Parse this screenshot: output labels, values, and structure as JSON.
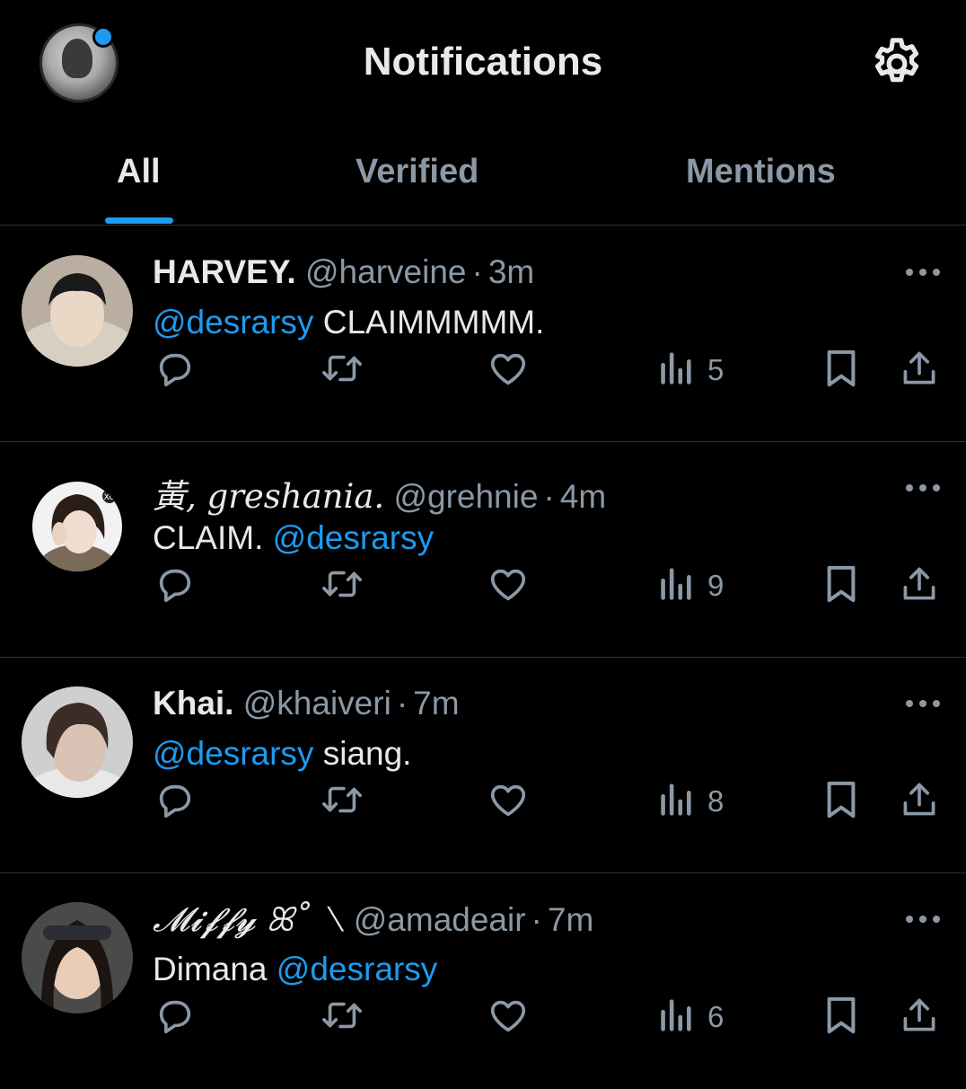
{
  "header": {
    "title": "Notifications",
    "icons": {
      "settings": "gear-icon",
      "notification_dot_color": "#1d9bf0"
    }
  },
  "tabs": [
    {
      "label": "All",
      "active": true
    },
    {
      "label": "Verified",
      "active": false
    },
    {
      "label": "Mentions",
      "active": false
    }
  ],
  "colors": {
    "accent": "#1d9bf0",
    "muted": "#8b98a5",
    "text": "#e7e9ea",
    "background": "#000000"
  },
  "posts": [
    {
      "name": "HARVEY.",
      "handle": "@harveine",
      "separator": "·",
      "time": "3m",
      "body": [
        {
          "mention": "@desrarsy"
        },
        {
          "text": " CLAIMMMMM."
        }
      ],
      "views": "5"
    },
    {
      "name": "黃, greshania.",
      "handle": "@grehnie",
      "separator": "·",
      "time": "4m",
      "body": [
        {
          "text": "CLAIM. "
        },
        {
          "mention": "@desrarsy"
        }
      ],
      "views": "9"
    },
    {
      "name": "Khai.",
      "handle": "@khaiveri",
      "separator": "·",
      "time": "7m",
      "body": [
        {
          "mention": "@desrarsy"
        },
        {
          "text": " siang."
        }
      ],
      "views": "8"
    },
    {
      "name": "𝓜𝓲𝓯𝓯𝔂 ꕤ˚ ⟍",
      "handle": "@amadeair",
      "separator": "·",
      "time": "7m",
      "body": [
        {
          "text": "Dimana "
        },
        {
          "mention": "@desrarsy"
        }
      ],
      "views": "6"
    }
  ]
}
